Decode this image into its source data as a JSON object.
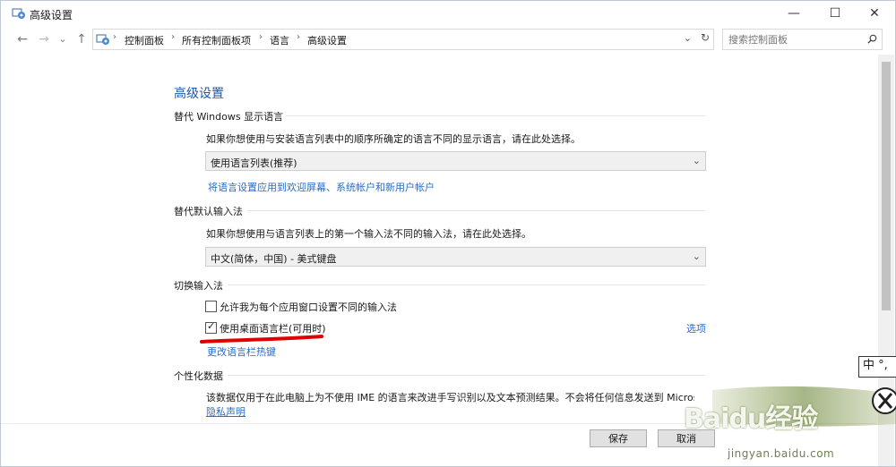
{
  "window": {
    "title": "高级设置",
    "controls": {
      "minimize": "—",
      "maximize": "☐",
      "close": "✕"
    }
  },
  "nav": {
    "back": "←",
    "forward": "→",
    "recent": "⌄",
    "up": "↑",
    "dropdown": "⌄",
    "refresh": "↻"
  },
  "breadcrumb": [
    "控制面板",
    "所有控制面板项",
    "语言",
    "高级设置"
  ],
  "search": {
    "placeholder": "搜索控制面板"
  },
  "page": {
    "heading": "高级设置",
    "display_language": {
      "title": "替代 Windows 显示语言",
      "description": "如果你想使用与安装语言列表中的顺序所确定的语言不同的显示语言，请在此处选择。",
      "selected": "使用语言列表(推荐)",
      "link": "将语言设置应用到欢迎屏幕、系统帐户和新用户帐户"
    },
    "default_input": {
      "title": "替代默认输入法",
      "description": "如果你想使用与语言列表上的第一个输入法不同的输入法，请在此处选择。",
      "selected": "中文(简体，中国) - 美式键盘"
    },
    "switch_input": {
      "title": "切换输入法",
      "per_app_label": "允许我为每个应用窗口设置不同的输入法",
      "per_app_checked": false,
      "language_bar_label": "使用桌面语言栏(可用时)",
      "language_bar_checked": true,
      "options_link": "选项",
      "hotkeys_link": "更改语言栏热键"
    },
    "personalization": {
      "title": "个性化数据",
      "description": "该数据仅用于在此电脑上为不使用 IME 的语言来改进手写识别以及文本预测结果。不会将任何信息发送到 Microsoft",
      "privacy_link": "隐私声明"
    }
  },
  "buttons": {
    "save": "保存",
    "cancel": "取消"
  },
  "ime_indicator": "中 °,",
  "watermark": {
    "brand": "Baidu经验",
    "site": "jingyan.baidu.com"
  },
  "colors": {
    "link": "#2a6cc6",
    "heading": "#1a5aa8",
    "annotation": "#e00000"
  }
}
